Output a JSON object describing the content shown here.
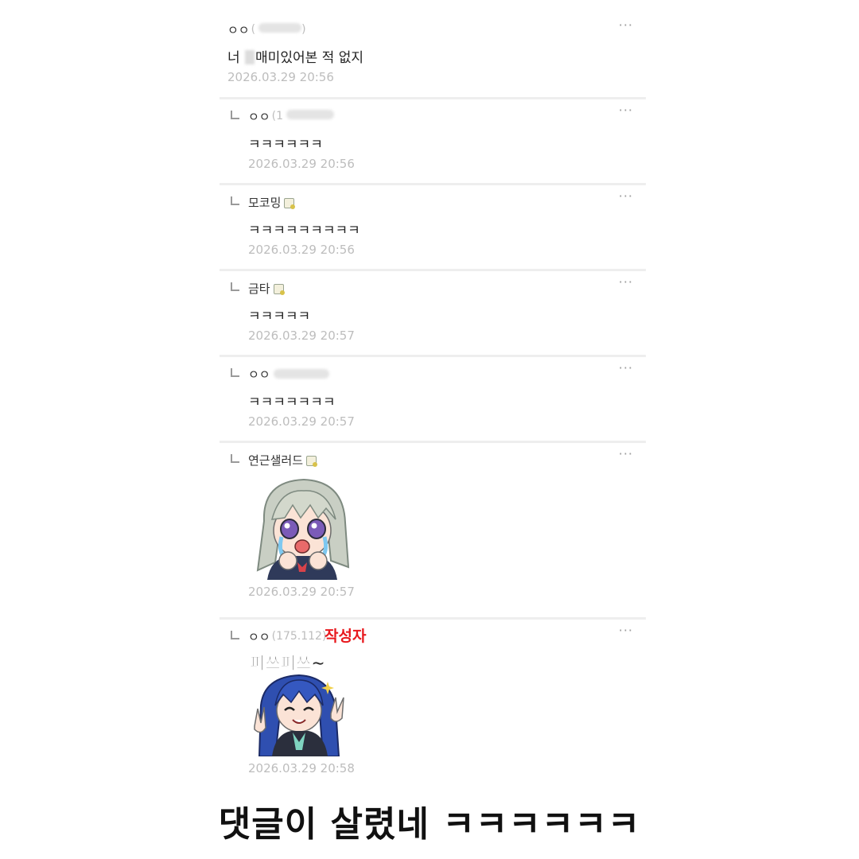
{
  "comments": [
    {
      "nick": "ㅇㅇ",
      "ip": "(",
      "ip_tail": ")",
      "text_pre": "너",
      "text_post": "매미있어본 적 없지",
      "time": "2026.03.29 20:56"
    },
    {
      "nick": "ㅇㅇ",
      "ip": "(1",
      "text": "ㅋㅋㅋㅋㅋㅋ",
      "time": "2026.03.29 20:56"
    },
    {
      "nick": "모코밍",
      "text": "ㅋㅋㅋㅋㅋㅋㅋㅋㅋ",
      "time": "2026.03.29 20:56"
    },
    {
      "nick": "금타",
      "text": "ㅋㅋㅋㅋㅋ",
      "time": "2026.03.29 20:57"
    },
    {
      "nick": "ㅇㅇ",
      "text": "ㅋㅋㅋㅋㅋㅋㅋ",
      "time": "2026.03.29 20:57"
    },
    {
      "nick": "연근샐러드",
      "time": "2026.03.29 20:57"
    },
    {
      "nick": "ㅇㅇ",
      "ip": "(175.112)",
      "author_tag": "작성자",
      "sticker_text": "피쓰피쓰~",
      "time": "2026.03.29 20:58"
    }
  ],
  "more_label": "···",
  "caption": "댓글이 살렸네 ㅋㅋㅋㅋㅋㅋ",
  "colors": {
    "author_tag": "#e8191e",
    "timestamp": "#bdbdbd",
    "divider": "#eeeeee"
  }
}
